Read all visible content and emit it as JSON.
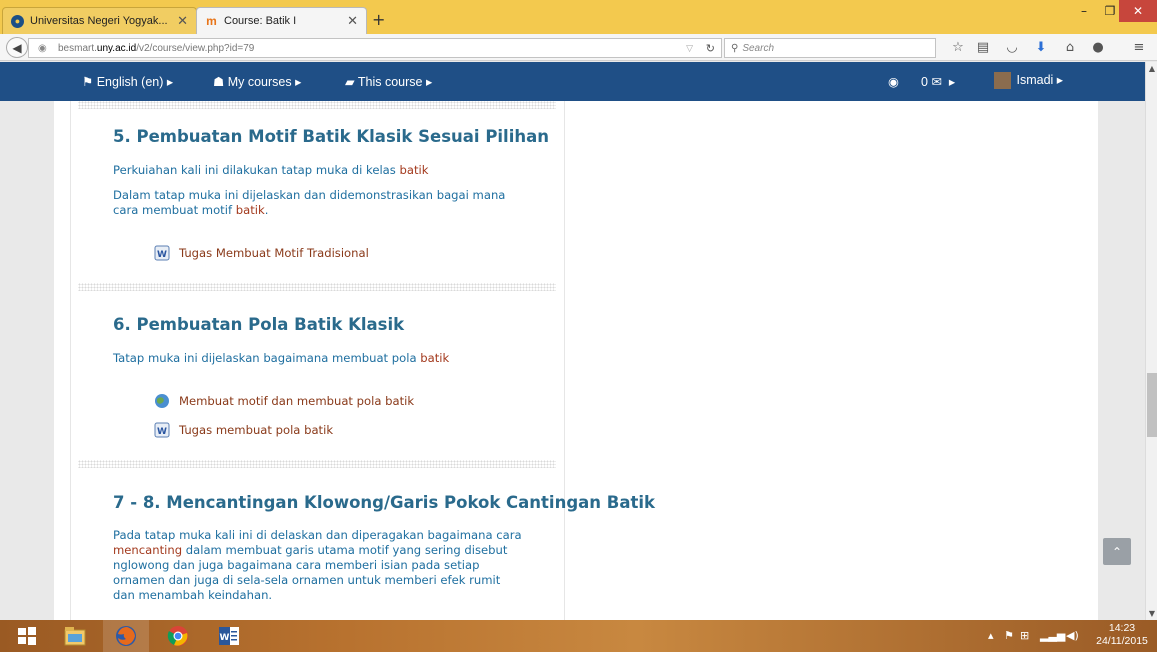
{
  "browser": {
    "tabs": [
      {
        "title": "Universitas Negeri Yogyak...",
        "active": false
      },
      {
        "title": "Course: Batik I",
        "active": true
      }
    ],
    "url_prefix": "besmart.",
    "url_host": "uny.ac.id",
    "url_path": "/v2/course/view.php?id=79",
    "search_placeholder": "Search"
  },
  "moodle_nav": {
    "language": "English (en)",
    "my_courses": "My courses",
    "this_course": "This course",
    "messages_count": "0",
    "user": "Ismadi"
  },
  "sections": [
    {
      "title": "5. Pembuatan Motif Batik Klasik Sesuai Pilihan",
      "summary_line1_pre": "Perkuiahan kali ini dilakukan tatap muka di kelas ",
      "summary_line1_hl": "batik",
      "summary_line2": "Dalam tatap muka ini dijelaskan dan didemonstrasikan bagai mana",
      "summary_line3_pre": "cara membuat motif ",
      "summary_line3_hl": "batik",
      "summary_line3_post": ".",
      "activities": [
        {
          "label": "Tugas Membuat Motif Tradisional",
          "icon": "assignment-icon"
        }
      ]
    },
    {
      "title": "6. Pembuatan Pola Batik Klasik",
      "summary_pre": "Tatap muka ini dijelaskan bagaimana membuat pola ",
      "summary_hl": "batik",
      "activities": [
        {
          "label": "Membuat motif dan membuat pola batik",
          "icon": "url-globe-icon"
        },
        {
          "label": "Tugas membuat pola batik",
          "icon": "assignment-icon"
        }
      ]
    },
    {
      "title": "7 - 8. Mencantingan Klowong/Garis Pokok Cantingan Batik",
      "lines": [
        "Pada tatap muka kali ini di delaskan dan diperagakan bagaimana cara",
        "mencanting",
        " dalam membuat garis utama motif yang sering disebut",
        "nglowong dan juga bagaimana cara memberi isian pada setiap",
        "ornamen dan juga di sela-sela ornamen untuk memberi efek rumit",
        "dan menambah keindahan."
      ]
    }
  ],
  "taskbar": {
    "time": "14:23",
    "date": "24/11/2015"
  },
  "colors": {
    "tab_bar": "#f3c94e",
    "moodle_nav": "#1f4f86",
    "section_title": "#2a6a8c",
    "body_text": "#1f6fa0",
    "highlight": "#a33a1e"
  }
}
